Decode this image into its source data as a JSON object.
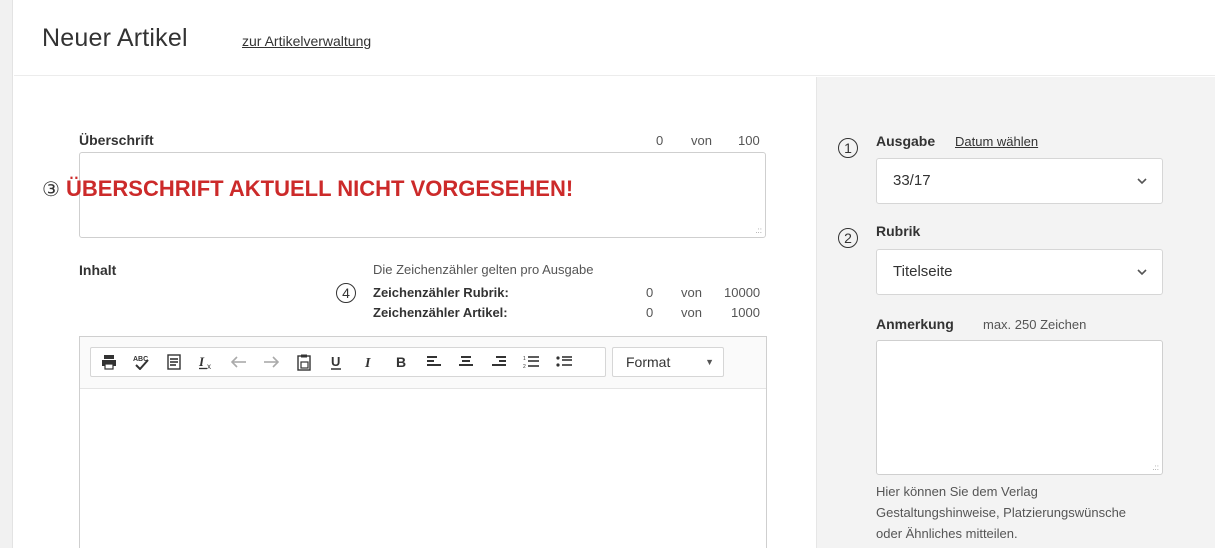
{
  "header": {
    "title": "Neuer Artikel",
    "admin_link": "zur Artikelverwaltung"
  },
  "heading_field": {
    "label": "Überschrift",
    "count": "0",
    "of": "von",
    "max": "100",
    "annotation_number": "③",
    "warning": "ÜBERSCHRIFT AKTUELL NICHT VORGESEHEN!"
  },
  "content_field": {
    "label": "Inhalt",
    "info": "Die Zeichenzähler gelten pro Ausgabe",
    "annotation_number": "4",
    "counter_rubrik": {
      "label": "Zeichenzähler Rubrik:",
      "count": "0",
      "of": "von",
      "max": "10000"
    },
    "counter_artikel": {
      "label": "Zeichenzähler Artikel:",
      "count": "0",
      "of": "von",
      "max": "1000"
    }
  },
  "toolbar": {
    "tools": [
      {
        "name": "print-icon",
        "glyph": "⎙"
      },
      {
        "name": "spellcheck-icon",
        "glyph": "ᴬᴮᶜ✓"
      },
      {
        "name": "paste-text-icon",
        "glyph": "▤"
      },
      {
        "name": "remove-format-icon",
        "glyph": "I̲ₓ"
      },
      {
        "name": "undo-icon",
        "glyph": "↶"
      },
      {
        "name": "redo-icon",
        "glyph": "↷"
      },
      {
        "name": "paste-word-icon",
        "glyph": "⎘"
      },
      {
        "name": "underline-icon",
        "glyph": "U"
      },
      {
        "name": "italic-icon",
        "glyph": "I"
      },
      {
        "name": "bold-icon",
        "glyph": "B"
      },
      {
        "name": "align-left-icon",
        "glyph": "≡"
      },
      {
        "name": "align-center-icon",
        "glyph": "≡"
      },
      {
        "name": "align-right-icon",
        "glyph": "≡"
      },
      {
        "name": "numbered-list-icon",
        "glyph": "⒈"
      },
      {
        "name": "bullet-list-icon",
        "glyph": "•≡"
      }
    ],
    "format_label": "Format"
  },
  "sidebar": {
    "ausgabe": {
      "annotation_number": "1",
      "label": "Ausgabe",
      "link": "Datum wählen",
      "value": "33/17"
    },
    "rubrik": {
      "annotation_number": "2",
      "label": "Rubrik",
      "value": "Titelseite"
    },
    "anmerkung": {
      "label": "Anmerkung",
      "hint": "max. 250 Zeichen",
      "help_line1": "Hier können Sie dem Verlag",
      "help_line2": "Gestaltungshinweise, Platzierungswünsche",
      "help_line3": "oder Ähnliches mitteilen."
    }
  }
}
